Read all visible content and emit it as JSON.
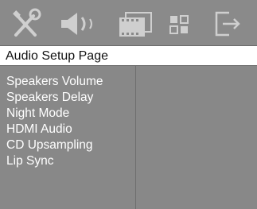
{
  "toolbar": {
    "items": [
      {
        "icon": "tools-icon"
      },
      {
        "icon": "speaker-icon"
      },
      {
        "icon": "film-icon"
      },
      {
        "icon": "preference-icon"
      },
      {
        "icon": "exit-icon"
      }
    ],
    "icon_color": "#cfcfcf",
    "background": "#8a8a8a"
  },
  "header": {
    "title": "Audio Setup Page"
  },
  "menu": {
    "items": [
      {
        "label": "Speakers Volume"
      },
      {
        "label": "Speakers Delay"
      },
      {
        "label": "Night Mode"
      },
      {
        "label": "HDMI Audio"
      },
      {
        "label": "CD Upsampling"
      },
      {
        "label": "Lip Sync"
      }
    ]
  },
  "colors": {
    "panel": "#888888",
    "text": "#ffffff",
    "header_bg": "#ffffff"
  }
}
